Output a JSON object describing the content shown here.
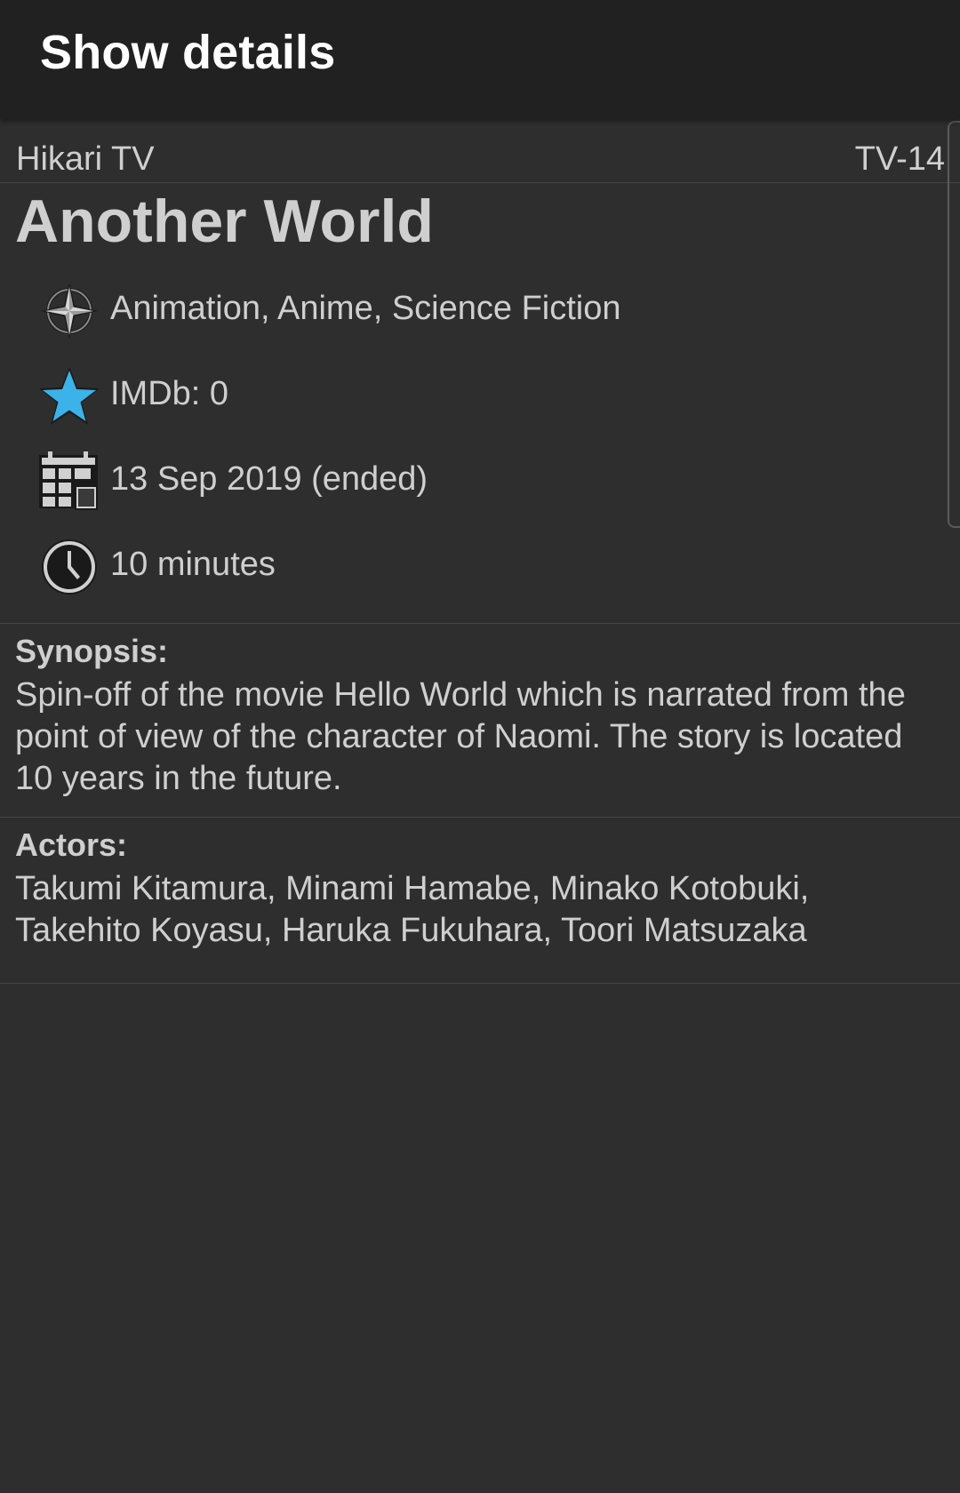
{
  "app_bar": {
    "title": "Show details"
  },
  "show": {
    "channel": "Hikari TV",
    "rating": "TV-14",
    "title": "Another World",
    "genres": "Animation, Anime, Science Fiction",
    "imdb": "IMDb: 0",
    "air_date": "13 Sep 2019 (ended)",
    "duration": "10 minutes"
  },
  "synopsis": {
    "label": "Synopsis:",
    "text": "Spin-off of the movie Hello World which is narrated from the point of view of the character of Naomi. The story is located 10 years in the future."
  },
  "actors": {
    "label": "Actors:",
    "text": "Takumi Kitamura, Minami Hamabe, Minako Kotobuki, Takehito Koyasu, Haruka Fukuhara, Toori Matsuzaka"
  },
  "icons": {
    "genre": "compass-star-icon",
    "imdb": "star-icon",
    "date": "calendar-icon",
    "duration": "clock-icon"
  },
  "colors": {
    "app_bar": "#212121",
    "background": "#2e2e2e",
    "text": "#cfcfcf",
    "star": "#3bb3e8"
  }
}
